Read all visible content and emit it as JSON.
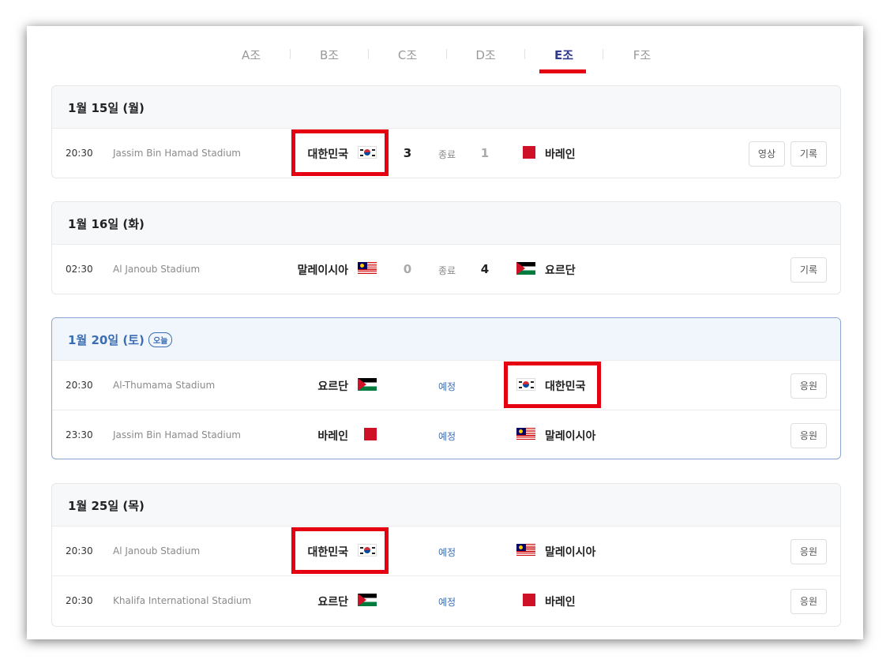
{
  "tabs": [
    {
      "label": "A조"
    },
    {
      "label": "B조"
    },
    {
      "label": "C조"
    },
    {
      "label": "D조"
    },
    {
      "label": "E조"
    },
    {
      "label": "F조"
    }
  ],
  "active_tab": "E조",
  "days": [
    {
      "date": "1월 15일 (월)",
      "matches": [
        {
          "time": "20:30",
          "stadium": "Jassim Bin Hamad Stadium",
          "home": "대한민국",
          "home_score": "3",
          "status": "종료",
          "away_score": "1",
          "away": "바레인",
          "buttons": [
            "영상",
            "기록"
          ]
        }
      ]
    },
    {
      "date": "1월 16일 (화)",
      "matches": [
        {
          "time": "02:30",
          "stadium": "Al Janoub Stadium",
          "home": "말레이시아",
          "home_score": "0",
          "status": "종료",
          "away_score": "4",
          "away": "요르단",
          "buttons": [
            "기록"
          ]
        }
      ]
    },
    {
      "date": "1월 20일 (토)",
      "today_badge": "오늘",
      "matches": [
        {
          "time": "20:30",
          "stadium": "Al-Thumama Stadium",
          "home": "요르단",
          "status": "예정",
          "away": "대한민국",
          "buttons": [
            "응원"
          ]
        },
        {
          "time": "23:30",
          "stadium": "Jassim Bin Hamad Stadium",
          "home": "바레인",
          "status": "예정",
          "away": "말레이시아",
          "buttons": [
            "응원"
          ]
        }
      ]
    },
    {
      "date": "1월 25일 (목)",
      "matches": [
        {
          "time": "20:30",
          "stadium": "Al Janoub Stadium",
          "home": "대한민국",
          "status": "예정",
          "away": "말레이시아",
          "buttons": [
            "응원"
          ]
        },
        {
          "time": "20:30",
          "stadium": "Khalifa International Stadium",
          "home": "요르단",
          "status": "예정",
          "away": "바레인",
          "buttons": [
            "응원"
          ]
        }
      ]
    }
  ],
  "colors": {
    "accent": "#2f3a8f",
    "highlight": "#e50012",
    "scheduled": "#3a6db3"
  }
}
